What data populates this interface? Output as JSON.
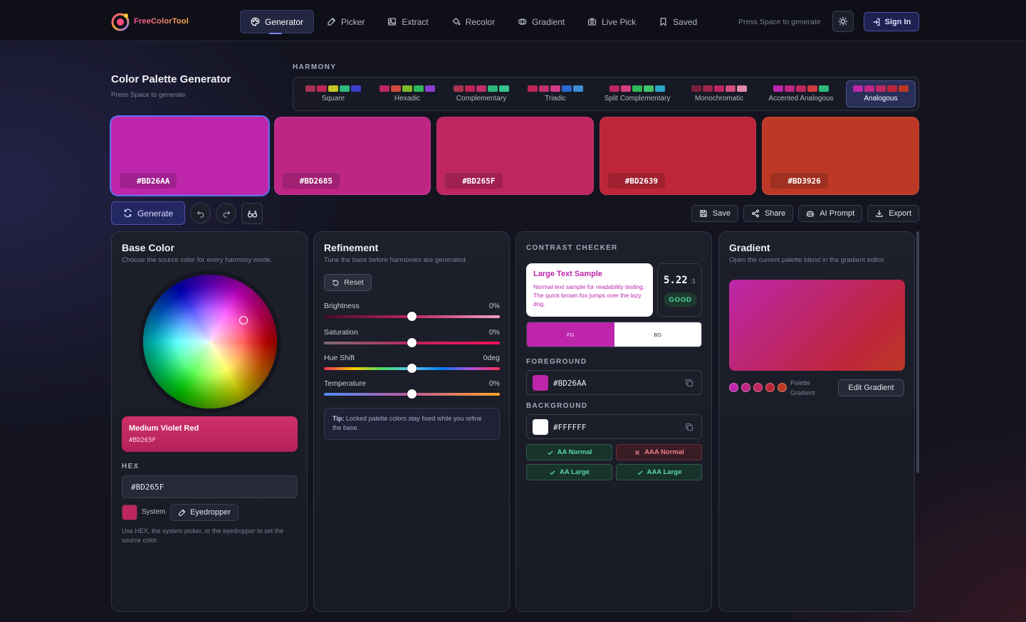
{
  "brand": {
    "name": "FreeColorTool"
  },
  "nav": [
    {
      "label": "Generator",
      "icon": "palette-icon",
      "active": true
    },
    {
      "label": "Picker",
      "icon": "pipette-icon"
    },
    {
      "label": "Extract",
      "icon": "image-icon"
    },
    {
      "label": "Recolor",
      "icon": "paint-bucket-icon"
    },
    {
      "label": "Gradient",
      "icon": "blend-icon"
    },
    {
      "label": "Live Pick",
      "icon": "camera-icon"
    },
    {
      "label": "Saved",
      "icon": "bookmark-icon"
    }
  ],
  "top_hint": "Press Space to generate",
  "signin_label": "Sign In",
  "page": {
    "title": "Color Palette Generator",
    "subtitle": "Press Space to generate"
  },
  "harmony": {
    "label": "HARMONY",
    "options": [
      {
        "name": "Square",
        "colors": [
          "#a8324f",
          "#bd2656",
          "#c7c42a",
          "#2fb87a",
          "#3b3fc9"
        ]
      },
      {
        "name": "Hexadic",
        "colors": [
          "#bd265f",
          "#d14a3e",
          "#7fba2a",
          "#2fb85a",
          "#8a3fd1"
        ]
      },
      {
        "name": "Complementary",
        "colors": [
          "#a8324f",
          "#bd2656",
          "#c02f6b",
          "#2fb87a",
          "#35c58d"
        ]
      },
      {
        "name": "Triadic",
        "colors": [
          "#bd2656",
          "#c02f6b",
          "#cf3a8a",
          "#2a68d1",
          "#3b8fd6"
        ]
      },
      {
        "name": "Split Complementary",
        "colors": [
          "#bd265f",
          "#d13f80",
          "#2fb85a",
          "#3fc46a",
          "#2aa6c4"
        ]
      },
      {
        "name": "Monochromatic",
        "colors": [
          "#7a1f3c",
          "#9e2548",
          "#bd265f",
          "#d14e7e",
          "#e08aa9"
        ]
      },
      {
        "name": "Accented Analogous",
        "colors": [
          "#bd26aa",
          "#bd2685",
          "#bd265f",
          "#d13a3e",
          "#2fb87a"
        ]
      },
      {
        "name": "Analogous",
        "colors": [
          "#bd26aa",
          "#bd2685",
          "#bd265f",
          "#bd2639",
          "#bd3926"
        ],
        "active": true
      }
    ]
  },
  "palette": [
    {
      "hex": "#BD26AA",
      "color": "#bd26aa",
      "selected": true
    },
    {
      "hex": "#BD2685",
      "color": "#bd2685"
    },
    {
      "hex": "#BD265F",
      "color": "#bd265f"
    },
    {
      "hex": "#BD2639",
      "color": "#bd2639"
    },
    {
      "hex": "#BD3926",
      "color": "#bd3926"
    }
  ],
  "actions": {
    "generate": "Generate",
    "buttons": [
      {
        "label": "Save",
        "icon": "save-icon"
      },
      {
        "label": "Share",
        "icon": "share-icon"
      },
      {
        "label": "AI Prompt",
        "icon": "robot-icon"
      },
      {
        "label": "Export",
        "icon": "download-icon"
      }
    ]
  },
  "base": {
    "title": "Base Color",
    "subtitle": "Choose the source color for every harmony mode.",
    "color_name": "Medium Violet Red",
    "color_hex": "#BD265F",
    "hex_label": "HEX",
    "hex_value": "#BD265F",
    "system_label": "System",
    "eyedropper_label": "Eyedropper",
    "help": "Use HEX, the system picker, or the eyedropper to set the source color."
  },
  "refinement": {
    "title": "Refinement",
    "subtitle": "Tune the base before harmonies are generated.",
    "reset": "Reset",
    "sliders": [
      {
        "label": "Brightness",
        "value": "0%",
        "pos": 0.5
      },
      {
        "label": "Saturation",
        "value": "0%",
        "pos": 0.5
      },
      {
        "label": "Hue Shift",
        "value": "0deg",
        "pos": 0.5
      },
      {
        "label": "Temperature",
        "value": "0%",
        "pos": 0.5
      }
    ],
    "tip_bold": "Tip:",
    "tip_text": " Locked palette colors stay fixed while you refine the base."
  },
  "contrast": {
    "title": "CONTRAST CHECKER",
    "sample_title": "Large Text Sample",
    "sample_body": "Normal text sample for readability testing. The quick brown fox jumps over the lazy dog.",
    "ratio": "5.22",
    "ratio_unit": ":1",
    "grade": "GOOD",
    "fg_label": "FG",
    "bg_label": "BG",
    "foreground_label": "FOREGROUND",
    "foreground_value": "#BD26AA",
    "foreground_color": "#bd26aa",
    "background_label": "BACKGROUND",
    "background_value": "#FFFFFF",
    "background_color": "#ffffff",
    "checks": [
      {
        "label": "AA Normal",
        "pass": true
      },
      {
        "label": "AAA Normal",
        "pass": false
      },
      {
        "label": "AA Large",
        "pass": true
      },
      {
        "label": "AAA Large",
        "pass": true
      }
    ]
  },
  "gradient": {
    "title": "Gradient",
    "subtitle": "Open the current palette blend in the gradient editor.",
    "palette_line1": "Palette",
    "palette_line2": "Gradient",
    "edit_label": "Edit Gradient"
  }
}
